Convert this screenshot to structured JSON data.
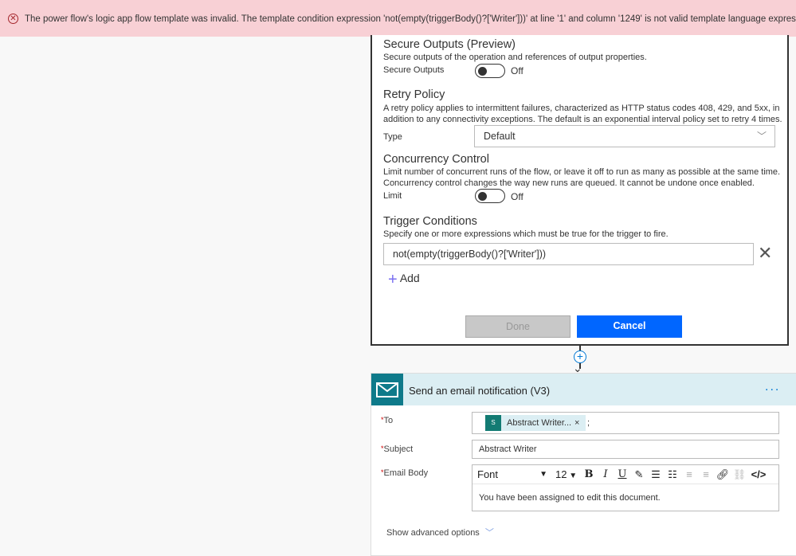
{
  "error_banner": {
    "icon": "error-circle-icon",
    "message": "The power flow's logic app flow template was invalid. The template condition expression 'not(empty(triggerBody()?['Writer']))' at line '1' and column '1249' is not valid template language expression.",
    "color": "#f8d0d5"
  },
  "settings": {
    "secure_outputs": {
      "title": "Secure Outputs (Preview)",
      "description": "Secure outputs of the operation and references of output properties.",
      "label": "Secure Outputs",
      "state": "Off"
    },
    "retry_policy": {
      "title": "Retry Policy",
      "description_1": "A retry policy applies to intermittent failures, characterized as HTTP status codes 408, 429, and 5xx, in",
      "description_2": "addition to any connectivity exceptions. The default is an exponential interval policy set to retry 4 times.",
      "label": "Type",
      "value": "Default"
    },
    "concurrency": {
      "title": "Concurrency Control",
      "description_1": "Limit number of concurrent runs of the flow, or leave it off to run as many as possible at the same time.",
      "description_2": "Concurrency control changes the way new runs are queued. It cannot be undone once enabled.",
      "label": "Limit",
      "state": "Off"
    },
    "trigger_conditions": {
      "title": "Trigger Conditions",
      "description": "Specify one or more expressions which must be true for the trigger to fire.",
      "expressions": [
        "not(empty(triggerBody()?['Writer']))"
      ],
      "add_label": "Add"
    },
    "done_label": "Done",
    "cancel_label": "Cancel",
    "accent": "#0066ff"
  },
  "email_action": {
    "title": "Send an email notification (V3)",
    "more": "...",
    "to_label": "To",
    "to_token": "Abstract Writer...",
    "to_separator": ";",
    "subject_label": "Subject",
    "subject_value": "Abstract Writer",
    "body_label": "Email Body",
    "font": "Font",
    "font_size": "12",
    "body_value": "You have been assigned to edit this document.",
    "advanced": "Show advanced options",
    "required_marker": "*"
  }
}
